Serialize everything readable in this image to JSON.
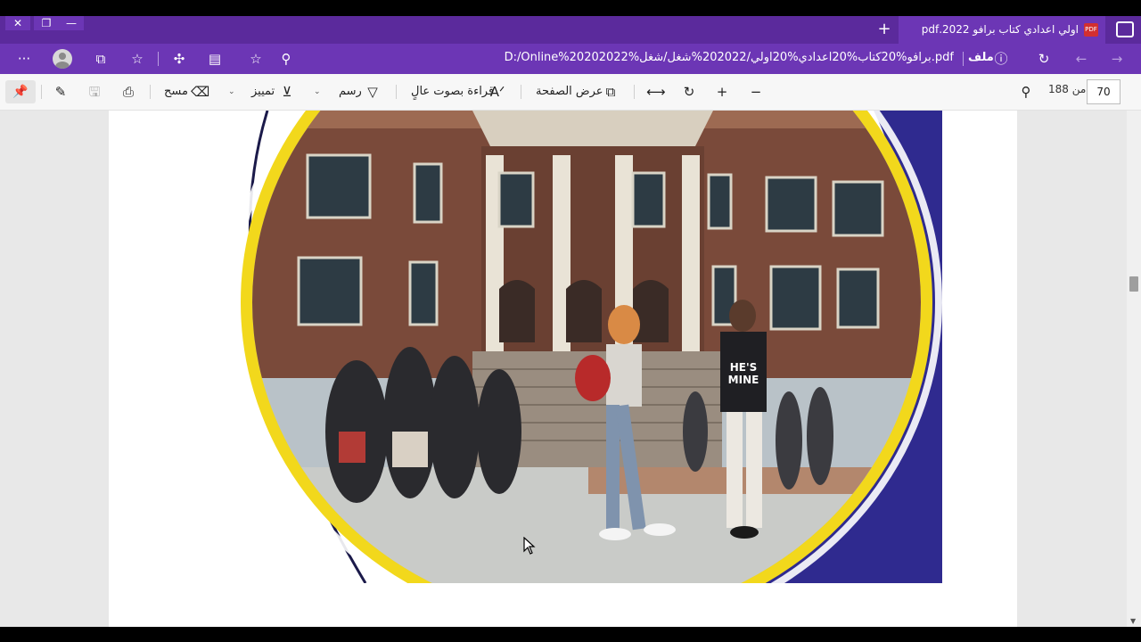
{
  "window": {
    "close_glyph": "✕",
    "restore_glyph": "❐",
    "minimize_glyph": "—"
  },
  "tab": {
    "title": "اولي اعدادي كتاب برافو 2022.pdf",
    "close_glyph": "✕",
    "new_tab_glyph": "+",
    "file_badge": "PDF"
  },
  "address_bar": {
    "url": "D:/Online%20202022%برافو%20كتاب%20اعدادي%20اولي/202022%شغل/شغل.pdf",
    "file_label": "ملف",
    "more_glyph": "···"
  },
  "pdf_toolbar": {
    "erase_label": "مسح",
    "highlight_label": "تمييز",
    "draw_label": "رسم",
    "read_aloud_label": "قراءة بصوت عالٍ",
    "page_view_label": "عرض الصفحة",
    "page_number": "70",
    "page_total": "من 188"
  },
  "icons": {
    "pin": "pin-icon",
    "ink": "add-notes-icon",
    "save": "save-icon",
    "print": "print-icon",
    "erase": "eraser-icon",
    "highlight": "highlighter-icon",
    "draw": "draw-pen-icon",
    "read_aloud": "read-aloud-icon",
    "page_view": "page-view-icon",
    "fit": "fit-to-width-icon",
    "rotate": "rotate-icon",
    "zoom_in": "zoom-in-icon",
    "zoom_out": "zoom-out-icon",
    "search": "search-icon"
  },
  "colors": {
    "frame": "#5b2a9c",
    "active_tab": "#6c36b5",
    "banner_yellow": "#f2d81c",
    "banner_blue": "#2f2a8f"
  },
  "page_image": {
    "sweatshirt_text_1": "HE'S",
    "sweatshirt_text_2": "MINE"
  }
}
